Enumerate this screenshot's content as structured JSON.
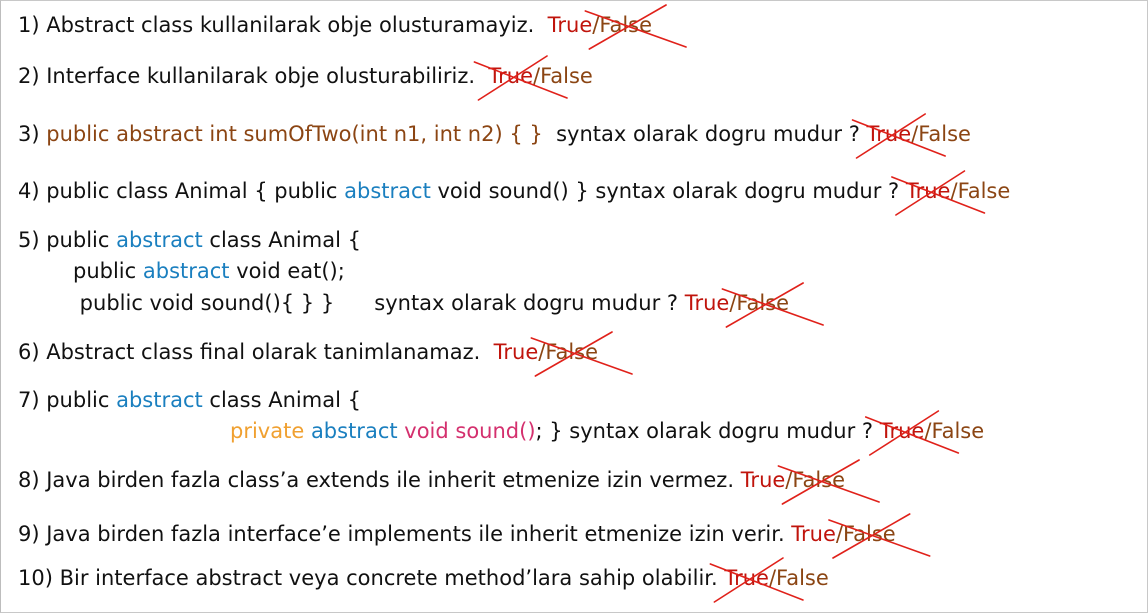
{
  "questions": [
    {
      "number": "1",
      "lines": [
        {
          "indent": 0,
          "segments": [
            {
              "text": "1) Abstract class kullanilarak obje olusturamayiz.  ",
              "color": "dark"
            },
            {
              "text": "True",
              "color": "red"
            },
            {
              "text": "/",
              "color": "brown"
            },
            {
              "text": "False",
              "color": "brown"
            }
          ]
        }
      ],
      "crossed": "False"
    },
    {
      "number": "2",
      "lines": [
        {
          "indent": 0,
          "segments": [
            {
              "text": "2) Interface kullanilarak obje olusturabiliriz.  ",
              "color": "dark"
            },
            {
              "text": "True",
              "color": "red"
            },
            {
              "text": "/",
              "color": "brown"
            },
            {
              "text": "False",
              "color": "brown"
            }
          ]
        }
      ],
      "crossed": "True"
    },
    {
      "number": "3",
      "lines": [
        {
          "indent": 0,
          "segments": [
            {
              "text": "3) ",
              "color": "dark"
            },
            {
              "text": "public abstract int sumOfTwo(int n1, int n2) { }",
              "color": "brown"
            },
            {
              "text": "  syntax olarak dogru mudur ? ",
              "color": "dark"
            },
            {
              "text": "True",
              "color": "red"
            },
            {
              "text": "/",
              "color": "brown"
            },
            {
              "text": "False",
              "color": "brown"
            }
          ]
        }
      ],
      "crossed": "True"
    },
    {
      "number": "4",
      "lines": [
        {
          "indent": 0,
          "segments": [
            {
              "text": "4) public class Animal { public ",
              "color": "dark"
            },
            {
              "text": "abstract",
              "color": "blue"
            },
            {
              "text": " void sound() } syntax olarak dogru mudur ? ",
              "color": "dark"
            },
            {
              "text": "True",
              "color": "red"
            },
            {
              "text": "/",
              "color": "brown"
            },
            {
              "text": "False",
              "color": "brown"
            }
          ]
        }
      ],
      "crossed": "True"
    },
    {
      "number": "5",
      "lines": [
        {
          "indent": 0,
          "segments": [
            {
              "text": "5) public ",
              "color": "dark"
            },
            {
              "text": "abstract",
              "color": "blue"
            },
            {
              "text": " class Animal {",
              "color": "dark"
            }
          ]
        },
        {
          "indent": 1,
          "segments": [
            {
              "text": "public ",
              "color": "dark"
            },
            {
              "text": "abstract",
              "color": "blue"
            },
            {
              "text": " void eat();",
              "color": "dark"
            }
          ]
        },
        {
          "indent": 1,
          "segments": [
            {
              "text": " public void sound(){ } }      syntax olarak dogru mudur ? ",
              "color": "dark"
            },
            {
              "text": "True",
              "color": "red"
            },
            {
              "text": "/",
              "color": "brown"
            },
            {
              "text": "False",
              "color": "brown"
            }
          ]
        }
      ],
      "crossed": "False"
    },
    {
      "number": "6",
      "lines": [
        {
          "indent": 0,
          "segments": [
            {
              "text": "6) Abstract class final olarak tanimlanamaz.  ",
              "color": "dark"
            },
            {
              "text": "True",
              "color": "red"
            },
            {
              "text": "/",
              "color": "brown"
            },
            {
              "text": "False",
              "color": "brown"
            }
          ]
        }
      ],
      "crossed": "False"
    },
    {
      "number": "7",
      "lines": [
        {
          "indent": 0,
          "segments": [
            {
              "text": "7) public ",
              "color": "dark"
            },
            {
              "text": "abstract",
              "color": "blue"
            },
            {
              "text": " class Animal {",
              "color": "dark"
            }
          ]
        },
        {
          "indent": 2,
          "segments": [
            {
              "text": "private",
              "color": "orange"
            },
            {
              "text": " ",
              "color": "dark"
            },
            {
              "text": "abstract",
              "color": "blue"
            },
            {
              "text": " void sound()",
              "color": "pink"
            },
            {
              "text": "; } syntax olarak dogru mudur ? ",
              "color": "dark"
            },
            {
              "text": "True",
              "color": "red"
            },
            {
              "text": "/",
              "color": "brown"
            },
            {
              "text": "False",
              "color": "brown"
            }
          ]
        }
      ],
      "crossed": "True"
    },
    {
      "number": "8",
      "lines": [
        {
          "indent": 0,
          "segments": [
            {
              "text": "8) Java birden fazla class’a extends ile inherit etmenize izin vermez. ",
              "color": "dark"
            },
            {
              "text": "True",
              "color": "red"
            },
            {
              "text": "/",
              "color": "brown"
            },
            {
              "text": "False",
              "color": "brown"
            }
          ]
        }
      ],
      "crossed": "False"
    },
    {
      "number": "9",
      "lines": [
        {
          "indent": 0,
          "segments": [
            {
              "text": "9) Java birden fazla interface’e implements ile inherit etmenize izin verir. ",
              "color": "dark"
            },
            {
              "text": "True",
              "color": "red"
            },
            {
              "text": "/",
              "color": "brown"
            },
            {
              "text": "False",
              "color": "brown"
            }
          ]
        }
      ],
      "crossed": "False"
    },
    {
      "number": "10",
      "lines": [
        {
          "indent": 0,
          "segments": [
            {
              "text": "10) Bir interface abstract veya concrete method’lara sahip olabilir. ",
              "color": "dark"
            },
            {
              "text": "True",
              "color": "red"
            },
            {
              "text": "/",
              "color": "brown"
            },
            {
              "text": "False",
              "color": "brown"
            }
          ]
        }
      ],
      "crossed": "True"
    }
  ],
  "colors": {
    "dark": "#111111",
    "brown": "#8b4513",
    "blue": "#1a7fbf",
    "red": "#c0140c",
    "orange": "#f0a030",
    "pink": "#d4306e",
    "cross_mark": "#e0211a"
  }
}
